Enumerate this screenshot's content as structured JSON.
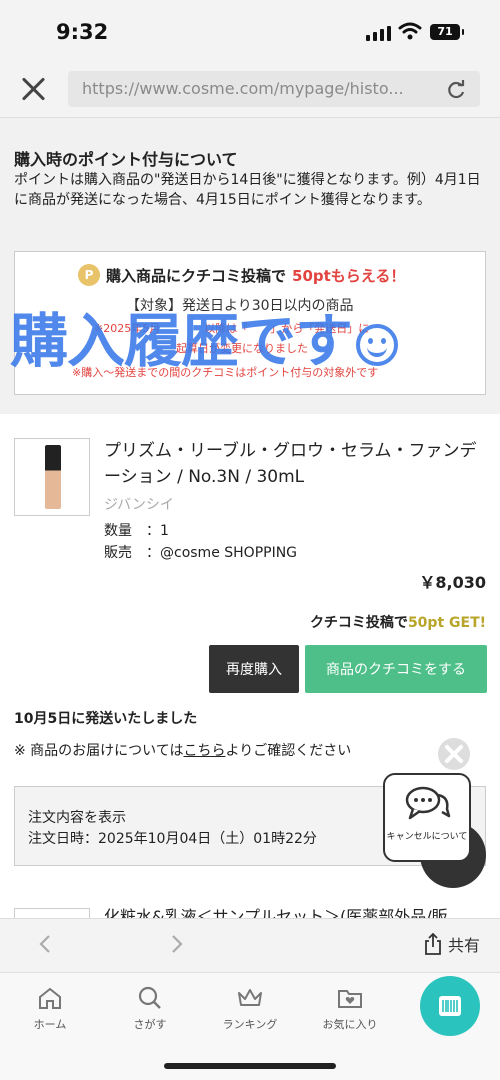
{
  "status_bar": {
    "time": "9:32",
    "battery": "71"
  },
  "browser": {
    "url": "https://www.cosme.com/mypage/histo..."
  },
  "points_info": {
    "title": "購入時のポイント付与について",
    "body": "ポイントは購入商品の\"発送日から14日後\"に獲得となります。例）4月1日に商品が発送になった場合、4月15日にポイント獲得となります。",
    "promo_head_prefix": "購入商品にクチコミ投稿で",
    "promo_head_highlight": "50ptもらえる！",
    "promo_target": "【対象】発送日より30日以内の商品",
    "promo_note1": "※2025年5月　　　　以降は「　　」から「発送日」に",
    "promo_note2": "起算日が変更になりました",
    "promo_note3": "※購入～発送までの間のクチコミはポイント付与の対象外です"
  },
  "overlay": {
    "text": "購入履歴です"
  },
  "product": {
    "name": "プリズム・リーブル・グロウ・セラム・ファンデーション / No.3N / 30mL",
    "brand": "ジバンシイ",
    "quantity": "数量　：1",
    "seller": "販売　：@cosme SHOPPING",
    "price": "￥8,030",
    "points_prefix": "クチコミ投稿で",
    "points_amount": "50pt GET!",
    "reorder_label": "再度購入",
    "review_label": "商品のクチコミをする"
  },
  "shipping": {
    "status": "10月5日に発送いたしました",
    "note_prefix": "※ 商品のお届けについては",
    "note_link": "こちら",
    "note_suffix": "よりご確認ください"
  },
  "order": {
    "view_label": "注文内容を表示",
    "date": "注文日時：2025年10月04日（土）01時22分",
    "cancel_label": "キャンセルについて"
  },
  "next_item": {
    "name": "化粧水&乳液＜サンプルセット＞(医薬部外品/販"
  },
  "browser_nav": {
    "share_label": "共有"
  },
  "tabs": [
    {
      "label": "ホーム",
      "icon": "home-icon"
    },
    {
      "label": "さがす",
      "icon": "search-icon"
    },
    {
      "label": "ランキング",
      "icon": "crown-icon"
    },
    {
      "label": "お気に入り",
      "icon": "favorite-folder-icon"
    }
  ],
  "colors": {
    "accent_green": "#4fbf8a",
    "promo_red": "#e2433f",
    "cart_teal": "#2bc3be",
    "overlay_blue": "#3878e8"
  }
}
